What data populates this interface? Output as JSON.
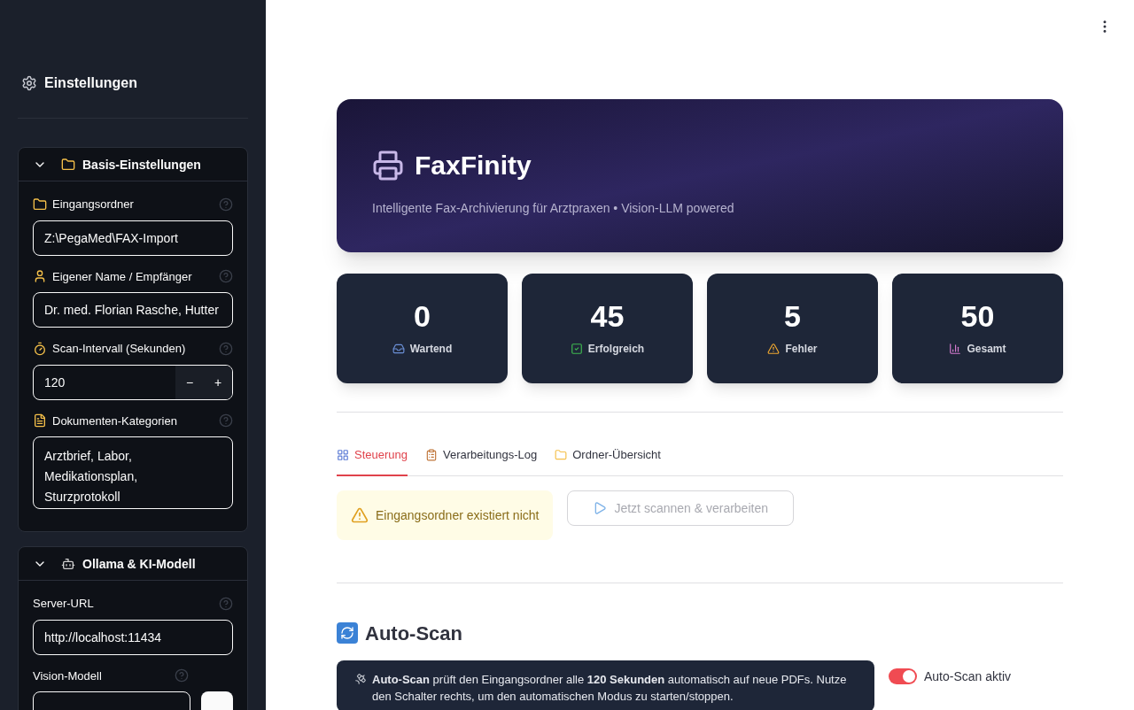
{
  "sidebar": {
    "title": "Einstellungen",
    "sections": [
      {
        "title": "Basis-Einstellungen",
        "expanded": true,
        "fields": [
          {
            "kind": "text",
            "label": "Eingangsordner",
            "value": "Z:\\PegaMed\\FAX-Import"
          },
          {
            "kind": "text",
            "label": "Eigener Name / Empfänger",
            "value": "Dr. med. Florian Rasche, Hutter"
          },
          {
            "kind": "number",
            "label": "Scan-Intervall (Sekunden)",
            "value": "120",
            "minus": "−",
            "plus": "+"
          },
          {
            "kind": "textarea",
            "label": "Dokumenten-Kategorien",
            "value": "Arztbrief, Labor,\nMedikationsplan,\nSturzprotokoll"
          }
        ]
      },
      {
        "title": "Ollama & KI-Modell",
        "expanded": true,
        "fields": [
          {
            "kind": "text",
            "label": "Server-URL",
            "value": "http://localhost:11434"
          },
          {
            "kind": "select",
            "label": "Vision-Modell"
          }
        ]
      }
    ]
  },
  "header": {
    "title": "FaxFinity",
    "subtitle": "Intelligente Fax-Archivierung für Arztpraxen • Vision-LLM powered"
  },
  "stats": [
    {
      "value": "0",
      "label": "Wartend",
      "kind": "waiting"
    },
    {
      "value": "45",
      "label": "Erfolgreich",
      "kind": "success"
    },
    {
      "value": "5",
      "label": "Fehler",
      "kind": "error"
    },
    {
      "value": "50",
      "label": "Gesamt",
      "kind": "total"
    }
  ],
  "tabs": [
    {
      "label": "Steuerung",
      "selected": true
    },
    {
      "label": "Verarbeitungs-Log",
      "selected": false
    },
    {
      "label": "Ordner-Übersicht",
      "selected": false
    }
  ],
  "alert": {
    "text": "Eingangsordner existiert nicht"
  },
  "scan_button": {
    "label": "Jetzt scannen & verarbeiten",
    "disabled": true
  },
  "auto_scan": {
    "heading": "Auto-Scan",
    "info": "**Auto-Scan** prüft den Eingangsordner alle **120 Sekunden** automatisch auf neue PDFs. Nutze den Schalter rechts, um den automatischen Modus zu starten/stoppen.",
    "toggle": {
      "label": "Auto-Scan aktiv",
      "on": true
    }
  }
}
